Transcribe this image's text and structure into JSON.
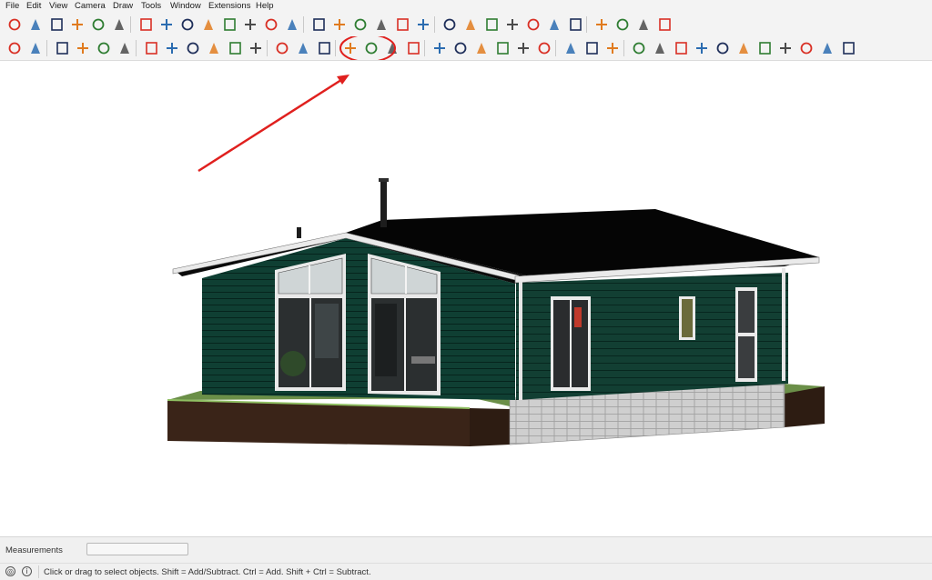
{
  "menu": [
    "File",
    "Edit",
    "View",
    "Camera",
    "Draw",
    "Tools",
    "Window",
    "Extensions",
    "Help"
  ],
  "colors": {
    "chrome_bg": "#f3f3f3",
    "siding": "#0f3f33",
    "roof": "#050505",
    "trim": "#e8e8e8",
    "foundation_block": "#c8c8c8",
    "soil": "#3a2418",
    "grass": "#5b8a3c",
    "annotation": "#e0201e",
    "toolbar_icon_red": "#d93025",
    "toolbar_icon_blue": "#2b6cb0"
  },
  "toolbar_row1": {
    "icons": [
      "make-component-icon",
      "eraser-icon",
      "paint-bucket-icon",
      "text-icon",
      "dimension-icon",
      "3d-text-icon",
      "orbit-icon",
      "pan-icon",
      "zoom-icon",
      "zoom-window-icon",
      "zoom-extents-icon",
      "previous-view-icon",
      "look-around-icon",
      "walk-icon",
      "iso-view-icon",
      "top-view-icon",
      "front-view-icon",
      "right-view-icon",
      "back-view-icon",
      "left-view-icon",
      "xray-icon",
      "back-edges-icon",
      "wireframe-icon",
      "hidden-line-icon",
      "shaded-icon",
      "shaded-textures-icon",
      "monochrome-icon",
      "section-plane-icon",
      "display-section-planes-icon",
      "display-section-cuts-icon",
      "display-section-fill-icon"
    ]
  },
  "toolbar_row2": {
    "icons": [
      "search-icon",
      "select-icon",
      "eraser-icon",
      "pencil-icon",
      "arc-icon",
      "rectangle-icon",
      "push-pull-icon",
      "follow-me-icon",
      "move-icon",
      "rotate-icon",
      "scale-icon",
      "offset-icon",
      "tape-measure-icon",
      "protractor-icon",
      "axes-icon",
      "orbit-highlighted-icon",
      "pan-highlighted-icon",
      "zoom-icon",
      "zoom-extents-icon",
      "shadows-icon",
      "fog-icon",
      "match-photo-icon",
      "edge-style-icon",
      "styles-icon",
      "scenes-icon",
      "new-file-icon",
      "user-icon",
      "model-info-icon",
      "sandbox-icon",
      "contour-icon",
      "drape-icon",
      "stamp-icon",
      "flip-edge-icon",
      "smoove-icon",
      "add-detail-icon",
      "hammer-icon",
      "extension-icon",
      "dynamic-component-icon",
      "interact-icon"
    ]
  },
  "measurements": {
    "label": "Measurements",
    "value": ""
  },
  "status": {
    "hint": "Click or drag to select objects. Shift = Add/Subtract. Ctrl = Add. Shift + Ctrl = Subtract.",
    "geo_icon": "geo-location-icon",
    "info_icon": "instructor-icon"
  }
}
